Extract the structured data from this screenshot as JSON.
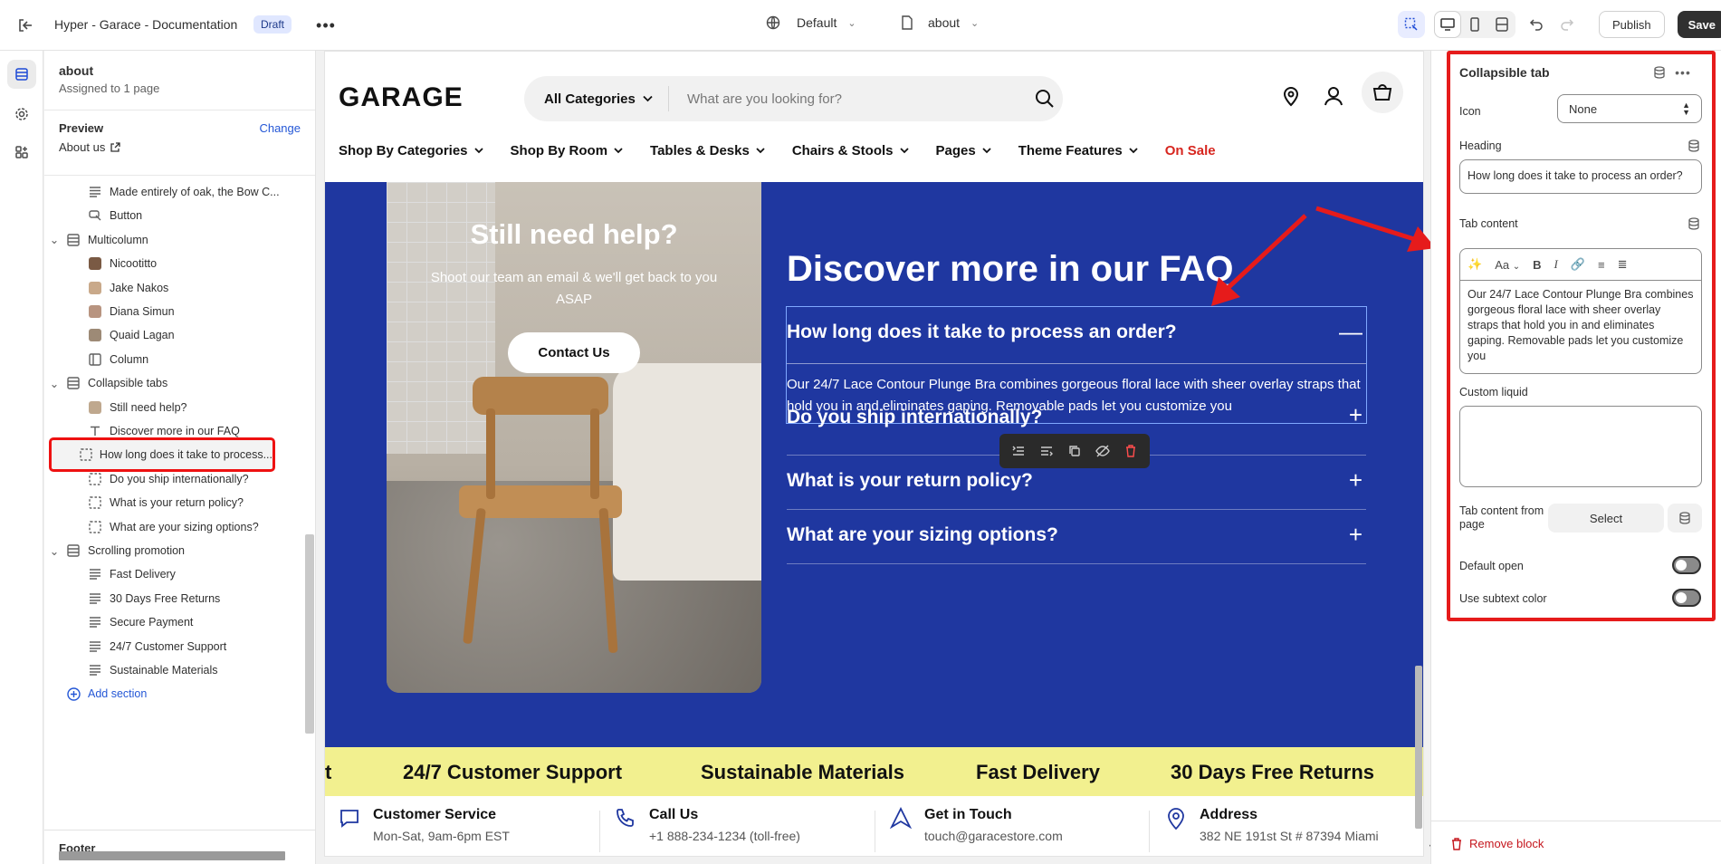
{
  "topbar": {
    "title": "Hyper - Garace - Documentation",
    "badge": "Draft",
    "theme_select": "Default",
    "page_select": "about",
    "publish_label": "Publish",
    "save_label": "Save"
  },
  "sidebar": {
    "page_name": "about",
    "assigned": "Assigned to 1 page",
    "preview_label": "Preview",
    "change_label": "Change",
    "preview_page": "About us",
    "items": [
      {
        "label": "Made entirely of oak, the Bow C...",
        "icon": "text-lines-icon",
        "indent": 2
      },
      {
        "label": "Button",
        "icon": "cursor-icon",
        "indent": 2
      },
      {
        "label": "Multicolumn",
        "icon": "section-icon",
        "indent": 1,
        "chevron": true
      },
      {
        "label": "Nicootitto",
        "icon": "avatar",
        "indent": 2,
        "color": "#7a5a44"
      },
      {
        "label": "Jake Nakos",
        "icon": "avatar",
        "indent": 2,
        "color": "#c9a98a"
      },
      {
        "label": "Diana Simun",
        "icon": "avatar",
        "indent": 2,
        "color": "#b89480"
      },
      {
        "label": "Quaid Lagan",
        "icon": "avatar",
        "indent": 2,
        "color": "#9d8a76"
      },
      {
        "label": "Column",
        "icon": "column-icon",
        "indent": 2
      },
      {
        "label": "Collapsible tabs",
        "icon": "section-icon",
        "indent": 1,
        "chevron": true
      },
      {
        "label": "Still need help?",
        "icon": "avatar",
        "indent": 2,
        "color": "#bfa88e"
      },
      {
        "label": "Discover more in our FAQ",
        "icon": "text-icon",
        "indent": 2
      },
      {
        "label": "How long does it take to process...",
        "icon": "block-icon",
        "indent": 2,
        "selected": true
      },
      {
        "label": "Do you ship internationally?",
        "icon": "block-icon",
        "indent": 2
      },
      {
        "label": "What is your return policy?",
        "icon": "block-icon",
        "indent": 2
      },
      {
        "label": "What are your sizing options?",
        "icon": "block-icon",
        "indent": 2
      },
      {
        "label": "Scrolling promotion",
        "icon": "section-icon",
        "indent": 1,
        "chevron": true
      },
      {
        "label": "Fast Delivery",
        "icon": "text-lines-icon",
        "indent": 2
      },
      {
        "label": "30 Days Free Returns",
        "icon": "text-lines-icon",
        "indent": 2
      },
      {
        "label": "Secure Payment",
        "icon": "text-lines-icon",
        "indent": 2
      },
      {
        "label": "24/7 Customer Support",
        "icon": "text-lines-icon",
        "indent": 2
      },
      {
        "label": "Sustainable Materials",
        "icon": "text-lines-icon",
        "indent": 2
      },
      {
        "label": "Add section",
        "icon": "plus-circle-icon",
        "indent": 1,
        "add": true
      }
    ],
    "footer_label": "Footer"
  },
  "store": {
    "logo": "GARAGE",
    "search_category": "All Categories",
    "search_placeholder": "What are you looking for?",
    "nav": [
      {
        "label": "Shop By Categories",
        "dropdown": true
      },
      {
        "label": "Shop By Room",
        "dropdown": true
      },
      {
        "label": "Tables & Desks",
        "dropdown": true
      },
      {
        "label": "Chairs & Stools",
        "dropdown": true
      },
      {
        "label": "Pages",
        "dropdown": true
      },
      {
        "label": "Theme Features",
        "dropdown": true
      },
      {
        "label": "On Sale",
        "dropdown": false,
        "sale": true
      }
    ],
    "help": {
      "title": "Still need help?",
      "text": "Shoot our team an email & we'll get back to you ASAP",
      "button": "Contact Us"
    },
    "faq": {
      "title": "Discover more in our FAQ",
      "items": [
        {
          "q": "How long does it take to process an order?",
          "a": "Our 24/7 Lace Contour Plunge Bra combines gorgeous floral lace with sheer overlay straps that hold you in and eliminates gaping. Removable pads let you customize you",
          "open": true
        },
        {
          "q": "Do you ship internationally?"
        },
        {
          "q": "What is your return policy?"
        },
        {
          "q": "What are your sizing options?"
        }
      ]
    },
    "promo": [
      "t",
      "24/7 Customer Support",
      "Sustainable Materials",
      "Fast Delivery",
      "30 Days Free Returns"
    ],
    "info": [
      {
        "title": "Customer Service",
        "sub": "Mon-Sat, 9am-6pm EST",
        "icon": "chat-icon"
      },
      {
        "title": "Call Us",
        "sub": "+1 888-234-1234 (toll-free)",
        "icon": "phone-icon"
      },
      {
        "title": "Get in Touch",
        "sub": "touch@garacestore.com",
        "icon": "send-icon"
      },
      {
        "title": "Address",
        "sub": "382 NE 191st St # 87394 Miami",
        "icon": "pin-icon"
      }
    ]
  },
  "panel": {
    "title": "Collapsible tab",
    "icon_label": "Icon",
    "icon_value": "None",
    "heading_label": "Heading",
    "heading_value": "How long does it take to process an order?",
    "tab_content_label": "Tab content",
    "tab_content_value": "Our 24/7 Lace Contour Plunge Bra combines gorgeous floral lace with sheer overlay straps that hold you in and eliminates gaping. Removable pads let you customize you",
    "custom_liquid_label": "Custom liquid",
    "from_page_label": "Tab content from page",
    "select_label": "Select",
    "default_open_label": "Default open",
    "subtext_label": "Use subtext color",
    "remove_label": "Remove block",
    "font_menu_label": "Aa"
  },
  "colors": {
    "accent": "#2457d6",
    "faq_bg": "#1f37a0",
    "promo_bg": "#f2f08f",
    "highlight": "#e61b1b",
    "sale": "#d7261f"
  }
}
